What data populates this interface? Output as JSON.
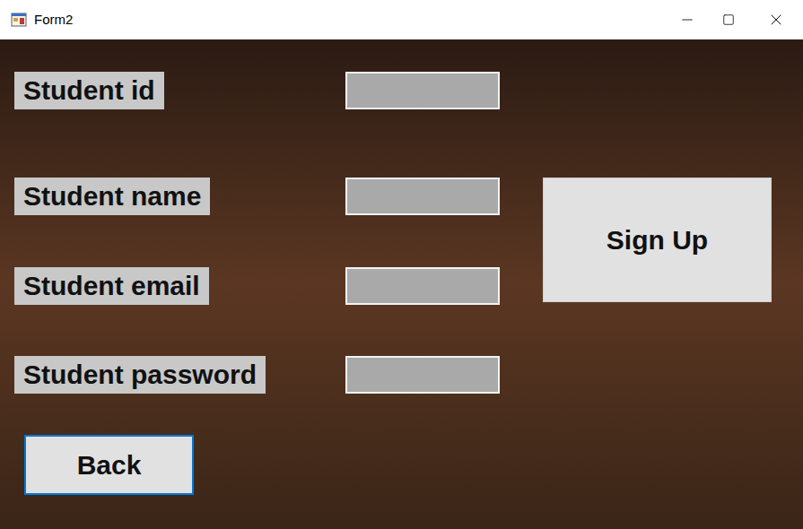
{
  "window": {
    "title": "Form2"
  },
  "fields": [
    {
      "label": "Student id",
      "value": ""
    },
    {
      "label": "Student name",
      "value": ""
    },
    {
      "label": "Student email",
      "value": ""
    },
    {
      "label": "Student password",
      "value": ""
    }
  ],
  "buttons": {
    "sign_up": "Sign Up",
    "back": "Back"
  }
}
